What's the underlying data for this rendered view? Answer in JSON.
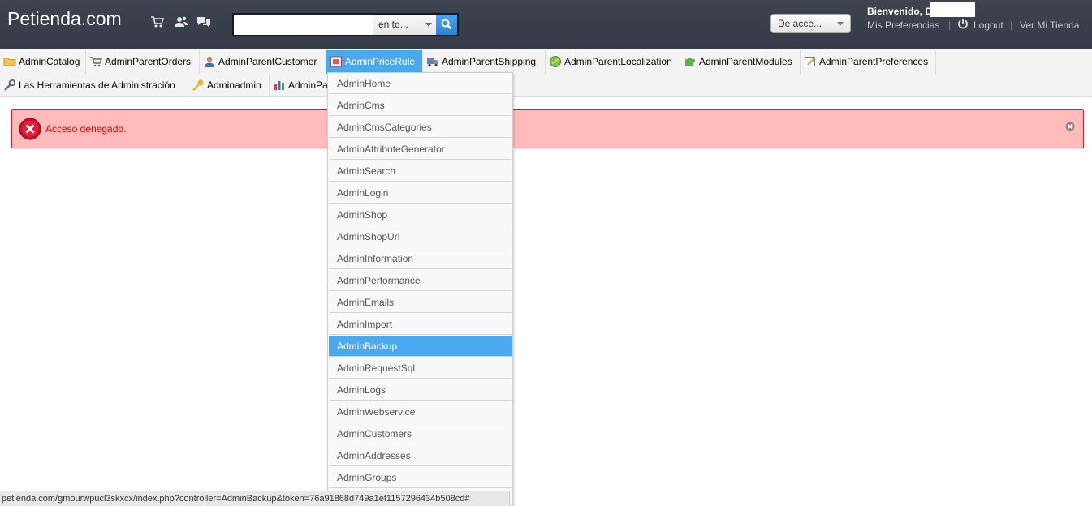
{
  "header": {
    "shop_name": "Petienda.com",
    "icons": [
      "cart-icon",
      "users-icon",
      "messages-icon"
    ],
    "search": {
      "placeholder": "",
      "value": "",
      "scope_label": "en to..."
    },
    "quick_access_label": "De acce...",
    "welcome_text": "Bienvenido, D",
    "preferences_link": "Mis Preferencias",
    "logout_link": "Logout",
    "view_shop_link": "Ver Mi Tienda",
    "separator": "|"
  },
  "tabs": [
    {
      "label": "AdminCatalog",
      "icon": "folder-icon"
    },
    {
      "label": "AdminParentOrders",
      "icon": "cart-icon"
    },
    {
      "label": "AdminParentCustomer",
      "icon": "customer-icon"
    },
    {
      "label": "AdminPriceRule",
      "icon": "price-rule-icon",
      "active": true
    },
    {
      "label": "AdminParentShipping",
      "icon": "truck-icon"
    },
    {
      "label": "AdminParentLocalization",
      "icon": "globe-icon"
    },
    {
      "label": "AdminParentModules",
      "icon": "puzzle-icon"
    },
    {
      "label": "AdminParentPreferences",
      "icon": "preferences-icon"
    },
    {
      "label": "Las Herramientas de Administración",
      "icon": "wrench-icon"
    },
    {
      "label": "Adminadmin",
      "icon": "key-icon"
    },
    {
      "label": "AdminPa",
      "icon": "stats-icon"
    }
  ],
  "alert": {
    "message": "Acceso denegado."
  },
  "dropdown": {
    "items": [
      "AdminHome",
      "AdminCms",
      "AdminCmsCategories",
      "AdminAttributeGenerator",
      "AdminSearch",
      "AdminLogin",
      "AdminShop",
      "AdminShopUrl",
      "AdminInformation",
      "AdminPerformance",
      "AdminEmails",
      "AdminImport",
      "AdminBackup",
      "AdminRequestSql",
      "AdminLogs",
      "AdminWebservice",
      "AdminCustomers",
      "AdminAddresses",
      "AdminGroups"
    ],
    "highlighted": "AdminBackup"
  },
  "status_bar": {
    "url": "petienda.com/gmourwpucl3skxcx/index.php?controller=AdminBackup&token=76a91868d749a1ef1157296434b508cd#"
  },
  "colors": {
    "header_bg": "#3a414c",
    "active_tab": "#4aa8ec",
    "alert_bg": "#ffbaba",
    "alert_border": "#d0202d",
    "alert_text": "#d8000c",
    "dropdown_highlight": "#4ba9f0"
  }
}
